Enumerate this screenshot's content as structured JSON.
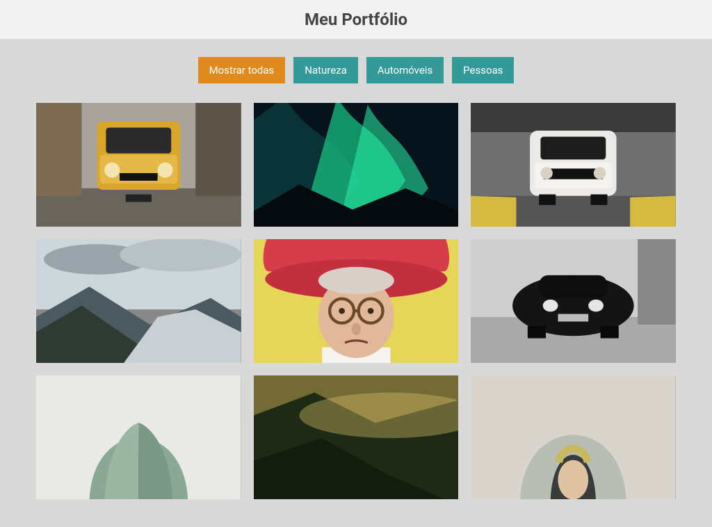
{
  "header": {
    "title": "Meu Portfólio"
  },
  "filters": [
    {
      "label": "Mostrar todas",
      "active": true
    },
    {
      "label": "Natureza",
      "active": false
    },
    {
      "label": "Automóveis",
      "active": false
    },
    {
      "label": "Pessoas",
      "active": false
    }
  ],
  "gallery": {
    "items": [
      {
        "category": "automoveis",
        "alt": "Carro amarelo vintage"
      },
      {
        "category": "natureza",
        "alt": "Aurora boreal"
      },
      {
        "category": "automoveis",
        "alt": "Mustang branco"
      },
      {
        "category": "natureza",
        "alt": "Montanhas e rio"
      },
      {
        "category": "pessoas",
        "alt": "Senhora de chapéu"
      },
      {
        "category": "automoveis",
        "alt": "Porsche preto"
      },
      {
        "category": "pessoas",
        "alt": "Pessoa de capuz verde"
      },
      {
        "category": "natureza",
        "alt": "Floresta ao amanhecer"
      },
      {
        "category": "pessoas",
        "alt": "Pessoa de capuz"
      }
    ]
  }
}
